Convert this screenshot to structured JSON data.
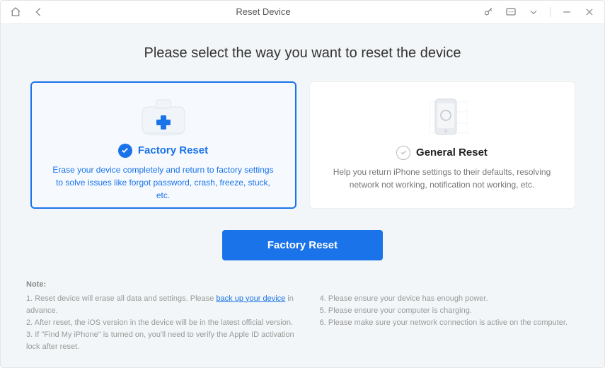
{
  "window": {
    "title": "Reset Device"
  },
  "heading": "Please select the way you want to reset the device",
  "cards": {
    "factory": {
      "title": "Factory Reset",
      "desc": "Erase your device completely and return to factory settings to solve issues like forgot password, crash, freeze, stuck, etc."
    },
    "general": {
      "title": "General Reset",
      "desc": "Help you return iPhone settings to their defaults, resolving network not working, notification not working, etc."
    }
  },
  "button": {
    "label": "Factory Reset"
  },
  "notes": {
    "label": "Note:",
    "left": {
      "n1a": "1. Reset device will erase all data and settings. Please ",
      "n1_link": "back up your device",
      "n1b": " in advance.",
      "n2": "2. After reset, the iOS version in the device will be in the latest official version.",
      "n3": "3. If \"Find My iPhone\" is turned on, you'll need to verify the Apple ID activation lock after reset."
    },
    "right": {
      "n4": "4. Please ensure your device has enough power.",
      "n5": "5. Please ensure your computer is charging.",
      "n6": "6. Please make sure your network connection is active on the computer."
    }
  }
}
